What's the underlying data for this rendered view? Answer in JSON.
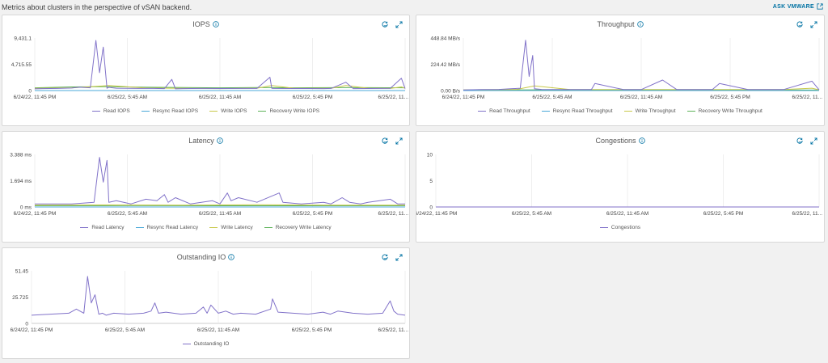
{
  "page": {
    "subtitle": "Metrics about clusters in the perspective of vSAN backend.",
    "ask_link": "ASK VMWARE"
  },
  "colors": {
    "Read": "#8172c9",
    "Resync": "#4aa8d8",
    "Write": "#c8c84a",
    "Recovery": "#5fb35a",
    "grid": "#e4e4e4",
    "axis": "#666666"
  },
  "icons": [
    "info-icon",
    "export-icon",
    "expand-icon",
    "external-link-icon"
  ],
  "chart_data": [
    {
      "id": "iops",
      "type": "line",
      "title": "IOPS",
      "y_ticks": [
        "9,431.1",
        "4,715.55",
        "0"
      ],
      "ylim": [
        0,
        9431.1
      ],
      "x_ticks": [
        "6/24/22, 11:45 PM",
        "6/25/22, 5:45 AM",
        "6/25/22, 11:45 AM",
        "6/25/22, 5:45 PM",
        "6/25/22, 11..."
      ],
      "series": [
        {
          "name": "Read IOPS",
          "color": "Read",
          "x": [
            0,
            0.02,
            0.06,
            0.08,
            0.1,
            0.12,
            0.15,
            0.165,
            0.175,
            0.185,
            0.195,
            0.2,
            0.21,
            0.22,
            0.28,
            0.32,
            0.35,
            0.37,
            0.38,
            0.4,
            0.45,
            0.5,
            0.56,
            0.6,
            0.635,
            0.64,
            0.645,
            0.7,
            0.78,
            0.8,
            0.84,
            0.86,
            0.9,
            0.96,
            0.99,
            1
          ],
          "y": [
            300,
            350,
            380,
            420,
            450,
            600,
            500,
            9000,
            3200,
            7800,
            400,
            600,
            500,
            420,
            380,
            380,
            350,
            2000,
            300,
            350,
            380,
            360,
            370,
            380,
            2400,
            400,
            380,
            360,
            350,
            380,
            1500,
            350,
            360,
            400,
            2200,
            350
          ]
        },
        {
          "name": "Resync Read IOPS",
          "color": "Resync",
          "x": [
            0,
            1
          ],
          "y": [
            0,
            0
          ]
        },
        {
          "name": "Write IOPS",
          "color": "Write",
          "x": [
            0,
            0.1,
            0.2,
            0.3,
            0.4,
            0.5,
            0.6,
            0.64,
            0.7,
            0.8,
            0.84,
            0.9,
            0.96,
            0.99,
            1
          ],
          "y": [
            400,
            500,
            900,
            450,
            400,
            350,
            420,
            900,
            400,
            400,
            900,
            420,
            380,
            650,
            400
          ]
        },
        {
          "name": "Recovery Write IOPS",
          "color": "Recovery",
          "x": [
            0,
            0.1,
            0.2,
            0.3,
            0.4,
            0.5,
            0.6,
            0.7,
            0.8,
            0.9,
            1
          ],
          "y": [
            500,
            650,
            700,
            600,
            550,
            500,
            550,
            500,
            520,
            520,
            500
          ]
        }
      ]
    },
    {
      "id": "throughput",
      "type": "line",
      "title": "Throughput",
      "y_ticks": [
        "448.84 MB/s",
        "224.42 MB/s",
        "0.00 B/s"
      ],
      "ylim": [
        0,
        448.84
      ],
      "x_ticks": [
        "6/24/22, 11:45 PM",
        "6/25/22, 5:45 AM",
        "6/25/22, 11:45 AM",
        "6/25/22, 5:45 PM",
        "6/25/22, 11..."
      ],
      "series": [
        {
          "name": "Read Throughput",
          "color": "Read",
          "x": [
            0,
            0.05,
            0.1,
            0.16,
            0.175,
            0.185,
            0.195,
            0.2,
            0.22,
            0.3,
            0.36,
            0.37,
            0.45,
            0.5,
            0.56,
            0.6,
            0.7,
            0.72,
            0.8,
            0.9,
            0.98,
            1
          ],
          "y": [
            5,
            8,
            10,
            20,
            430,
            120,
            300,
            15,
            10,
            8,
            8,
            60,
            8,
            8,
            90,
            8,
            8,
            60,
            8,
            8,
            80,
            6
          ]
        },
        {
          "name": "Resync Read Throughput",
          "color": "Resync",
          "x": [
            0,
            1
          ],
          "y": [
            0,
            0
          ]
        },
        {
          "name": "Write Throughput",
          "color": "Write",
          "x": [
            0,
            0.15,
            0.2,
            0.3,
            0.5,
            0.7,
            0.9,
            0.98,
            1
          ],
          "y": [
            6,
            10,
            40,
            8,
            8,
            8,
            8,
            20,
            6
          ]
        },
        {
          "name": "Recovery Write Throughput",
          "color": "Recovery",
          "x": [
            0,
            0.2,
            0.4,
            0.6,
            0.8,
            1
          ],
          "y": [
            4,
            6,
            5,
            5,
            5,
            4
          ]
        }
      ]
    },
    {
      "id": "latency",
      "type": "line",
      "title": "Latency",
      "y_ticks": [
        "3.388 ms",
        "1.694 ms",
        "0 ms"
      ],
      "ylim": [
        0,
        3.388
      ],
      "x_ticks": [
        "6/24/22, 11:45 PM",
        "6/25/22, 5:45 AM",
        "6/25/22, 11:45 AM",
        "6/25/22, 5:45 PM",
        "6/25/22, 11..."
      ],
      "series": [
        {
          "name": "Read Latency",
          "color": "Read",
          "x": [
            0,
            0.1,
            0.16,
            0.175,
            0.185,
            0.195,
            0.2,
            0.22,
            0.26,
            0.3,
            0.33,
            0.35,
            0.36,
            0.38,
            0.42,
            0.48,
            0.5,
            0.52,
            0.53,
            0.55,
            0.6,
            0.66,
            0.67,
            0.72,
            0.78,
            0.8,
            0.83,
            0.85,
            0.88,
            0.9,
            0.96,
            0.98,
            1
          ],
          "y": [
            0.2,
            0.2,
            0.3,
            3.2,
            1.6,
            3.0,
            0.3,
            0.4,
            0.2,
            0.5,
            0.4,
            0.8,
            0.3,
            0.6,
            0.2,
            0.4,
            0.2,
            0.9,
            0.4,
            0.6,
            0.3,
            0.9,
            0.3,
            0.2,
            0.3,
            0.2,
            0.6,
            0.3,
            0.2,
            0.3,
            0.5,
            0.2,
            0.2
          ]
        },
        {
          "name": "Resync Read Latency",
          "color": "Resync",
          "x": [
            0,
            1
          ],
          "y": [
            0,
            0
          ]
        },
        {
          "name": "Write Latency",
          "color": "Write",
          "x": [
            0,
            0.2,
            0.4,
            0.6,
            0.8,
            1
          ],
          "y": [
            0.12,
            0.13,
            0.12,
            0.14,
            0.12,
            0.12
          ]
        },
        {
          "name": "Recovery Write Latency",
          "color": "Recovery",
          "x": [
            0,
            0.25,
            0.5,
            0.75,
            1
          ],
          "y": [
            0.08,
            0.09,
            0.08,
            0.08,
            0.08
          ]
        }
      ]
    },
    {
      "id": "congestions",
      "type": "line",
      "title": "Congestions",
      "y_ticks": [
        "10",
        "5",
        "0"
      ],
      "ylim": [
        0,
        10
      ],
      "x_ticks": [
        "6/24/22, 11:45 PM",
        "6/25/22, 5:45 AM",
        "6/25/22, 11:45 AM",
        "6/25/22, 5:45 PM",
        "6/25/22, 11..."
      ],
      "series": [
        {
          "name": "Congestions",
          "color": "Read",
          "x": [
            0,
            1
          ],
          "y": [
            0,
            0
          ]
        }
      ]
    },
    {
      "id": "outstanding",
      "type": "line",
      "title": "Outstanding IO",
      "y_ticks": [
        "51.45",
        "25.725",
        "0"
      ],
      "ylim": [
        0,
        51.45
      ],
      "x_ticks": [
        "6/24/22, 11:45 PM",
        "6/25/22, 5:45 AM",
        "6/25/22, 11:45 AM",
        "6/25/22, 5:45 PM",
        "6/25/22, 11..."
      ],
      "series": [
        {
          "name": "Outstanding IO",
          "color": "Read",
          "x": [
            0,
            0.05,
            0.1,
            0.12,
            0.14,
            0.15,
            0.16,
            0.17,
            0.18,
            0.19,
            0.2,
            0.22,
            0.26,
            0.3,
            0.32,
            0.33,
            0.34,
            0.36,
            0.4,
            0.44,
            0.46,
            0.47,
            0.48,
            0.5,
            0.52,
            0.54,
            0.56,
            0.6,
            0.64,
            0.645,
            0.66,
            0.7,
            0.74,
            0.78,
            0.8,
            0.82,
            0.86,
            0.9,
            0.94,
            0.96,
            0.97,
            0.98,
            1
          ],
          "y": [
            8,
            9,
            10,
            14,
            10,
            46,
            20,
            28,
            9,
            10,
            8,
            10,
            9,
            10,
            12,
            20,
            10,
            11,
            9,
            10,
            16,
            10,
            18,
            10,
            12,
            9,
            10,
            9,
            14,
            24,
            11,
            10,
            9,
            11,
            9,
            12,
            10,
            9,
            10,
            22,
            12,
            9,
            8
          ]
        }
      ]
    }
  ]
}
